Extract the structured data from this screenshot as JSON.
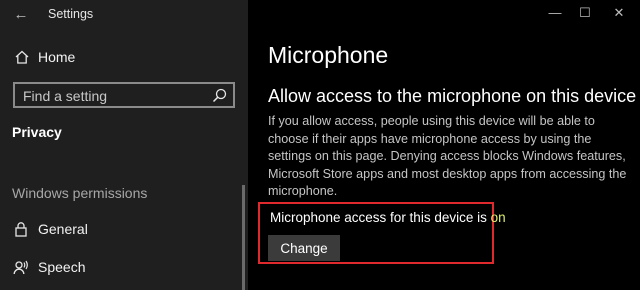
{
  "window": {
    "title": "Settings",
    "controls": {
      "minimize": "—",
      "maximize": "☐",
      "close": "✕"
    }
  },
  "sidebar": {
    "home": {
      "label": "Home",
      "icon": "home-icon"
    },
    "search": {
      "placeholder": "Find a setting",
      "value": "",
      "icon": "search-icon"
    },
    "current_section": "Privacy",
    "group_heading": "Windows permissions",
    "items": [
      {
        "label": "General",
        "icon": "lock-icon"
      },
      {
        "label": "Speech",
        "icon": "speech-icon"
      }
    ]
  },
  "main": {
    "title": "Microphone",
    "heading": "Allow access to the microphone on this device",
    "description": "If you allow access, people using this device will be able to choose if their apps have microphone access by using the settings on this page. Denying access blocks Windows features, Microsoft Store apps and most desktop apps from accessing the microphone.",
    "status_prefix": "Microphone access for this device is",
    "status_value": "on",
    "change_button": "Change"
  },
  "colors": {
    "sidebar_bg": "#1f1f1f",
    "main_bg": "#000000",
    "status_on": "#e0ef70",
    "highlight_border": "#e0292d",
    "button_bg": "#3b3b3b"
  }
}
